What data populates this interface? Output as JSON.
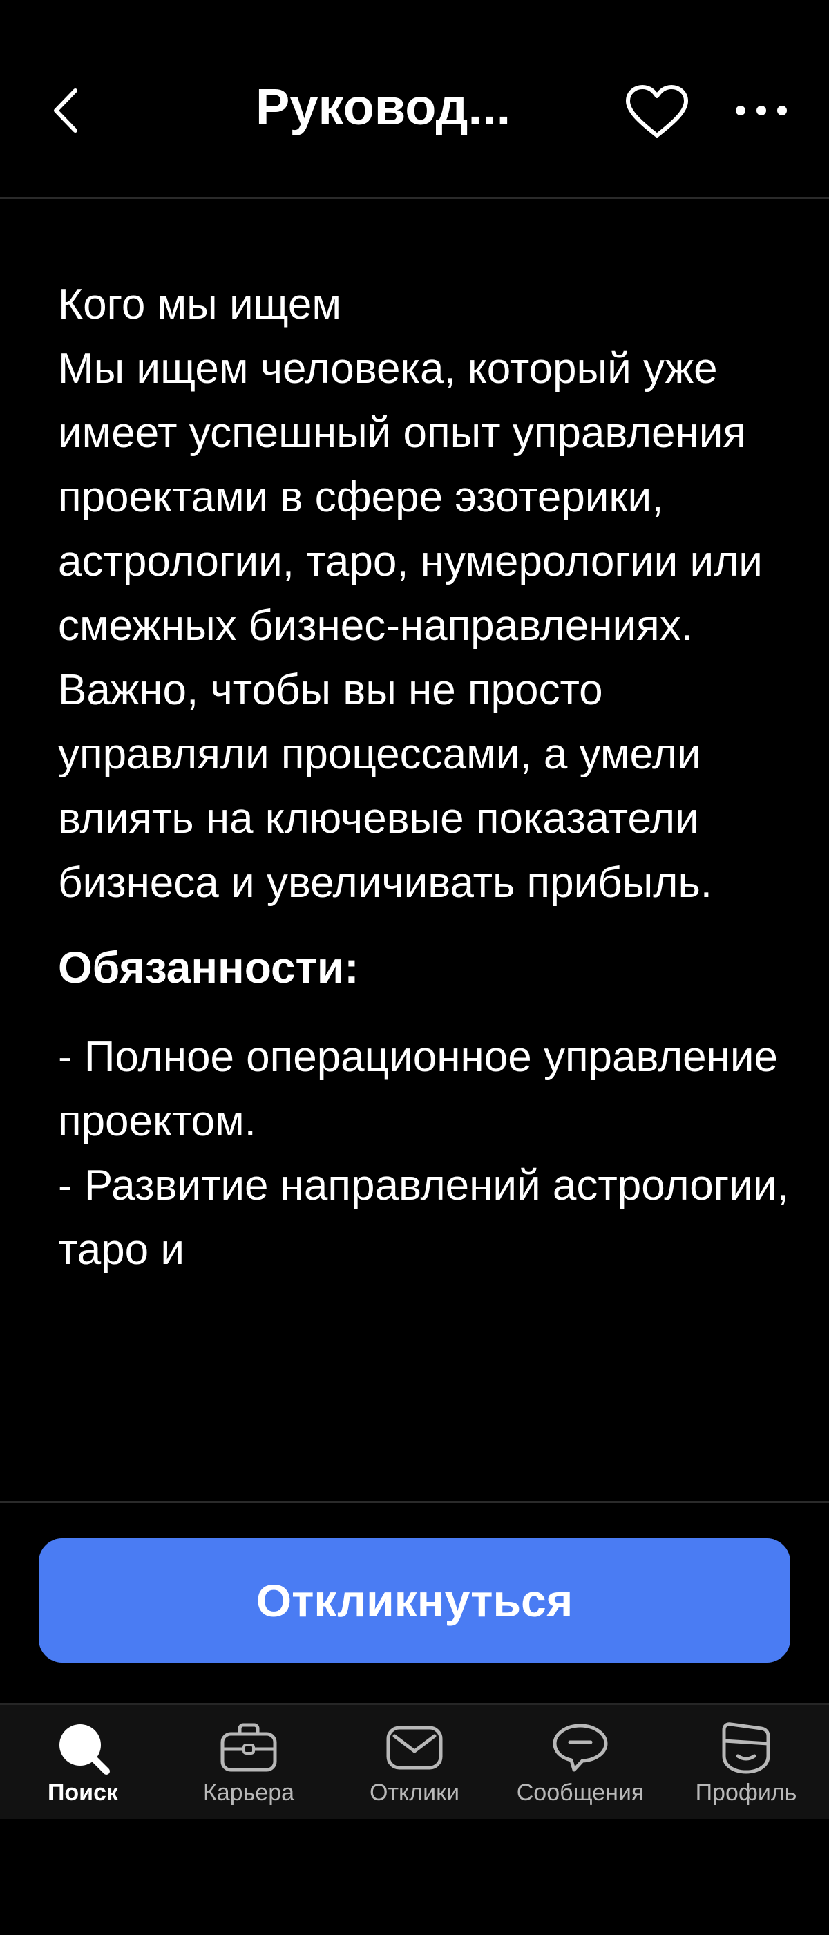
{
  "header": {
    "title": "Руковод...",
    "back_icon": "chevron-left-icon",
    "favorite_icon": "heart-icon",
    "more_icon": "more-horizontal-icon"
  },
  "content": {
    "intro": "Кого мы ищем\nМы ищем человека, который уже имеет успешный опыт управления проектами в сфере эзотерики, астрологии, таро, нумерологии или смежных бизнес-направлениях. Важно, чтобы вы не просто управляли процессами, а умели влиять на ключевые показатели бизнеса и увеличивать прибыль.",
    "duties_title": "Обязанности:",
    "duties": "- Полное операционное управление проектом.\n- Развитие направлений астрологии, таро и"
  },
  "apply_button": {
    "label": "Откликнуться",
    "color": "#4a7cf3"
  },
  "nav": {
    "items": [
      {
        "label": "Поиск",
        "icon": "search-icon",
        "active": true
      },
      {
        "label": "Карьера",
        "icon": "briefcase-icon",
        "active": false
      },
      {
        "label": "Отклики",
        "icon": "envelope-icon",
        "active": false
      },
      {
        "label": "Сообщения",
        "icon": "chat-bubble-icon",
        "active": false
      },
      {
        "label": "Профиль",
        "icon": "profile-face-icon",
        "active": false
      }
    ]
  }
}
